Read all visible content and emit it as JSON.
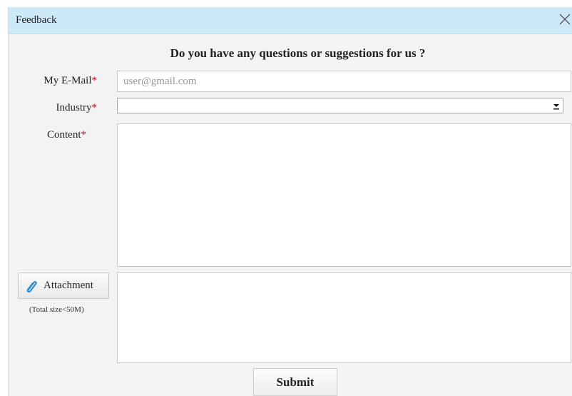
{
  "dialog": {
    "title": "Feedback",
    "heading": "Do you have any questions or suggestions for us ?"
  },
  "form": {
    "email_label": "My E-Mail",
    "email_placeholder": "user@gmail.com",
    "email_value": "",
    "industry_label": "Industry",
    "industry_selected": "",
    "content_label": "Content",
    "required_mark": "*",
    "attachment_button": "Attachment",
    "attachment_note": "(Total size<50M)",
    "submit_label": "Submit"
  },
  "icons": {
    "close": "close-icon",
    "paperclip": "paperclip-icon",
    "dropdown": "dropdown-arrow-icon"
  },
  "colors": {
    "titlebar_bg": "#cde9f7",
    "required": "#d0021b",
    "paperclip": "#2f8fd0"
  }
}
